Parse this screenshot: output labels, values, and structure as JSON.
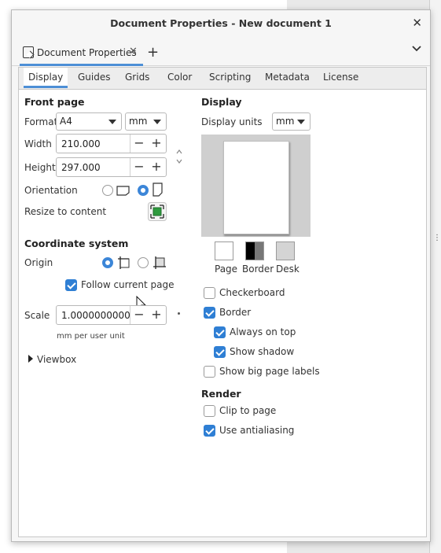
{
  "window": {
    "title": "Document Properties - New document 1"
  },
  "doc_tab": {
    "label": "Document Properties"
  },
  "tabs": [
    "Display",
    "Guides",
    "Grids",
    "Color",
    "Scripting",
    "Metadata",
    "License"
  ],
  "front_page": {
    "heading": "Front page",
    "format_label": "Format",
    "format_value": "A4",
    "unit_value": "mm",
    "width_label": "Width",
    "width_value": "210.000",
    "height_label": "Height",
    "height_value": "297.000",
    "orientation_label": "Orientation",
    "resize_label": "Resize to content"
  },
  "coordinate_system": {
    "heading": "Coordinate system",
    "origin_label": "Origin",
    "follow_label": "Follow current page",
    "scale_label": "Scale",
    "scale_value": "1.0000000000",
    "scale_unit": "mm per user unit",
    "viewbox_label": "Viewbox"
  },
  "display": {
    "heading": "Display",
    "units_label": "Display units",
    "units_value": "mm",
    "swatches": [
      "Page",
      "Border",
      "Desk"
    ],
    "checkerboard": "Checkerboard",
    "border": "Border",
    "always_on_top": "Always on top",
    "show_shadow": "Show shadow",
    "show_big_labels": "Show big page labels"
  },
  "render": {
    "heading": "Render",
    "clip": "Clip to page",
    "antialias": "Use antialiasing"
  },
  "colors": {
    "accent": "#3c86d8",
    "tab_underline": "#4d8fd6"
  }
}
